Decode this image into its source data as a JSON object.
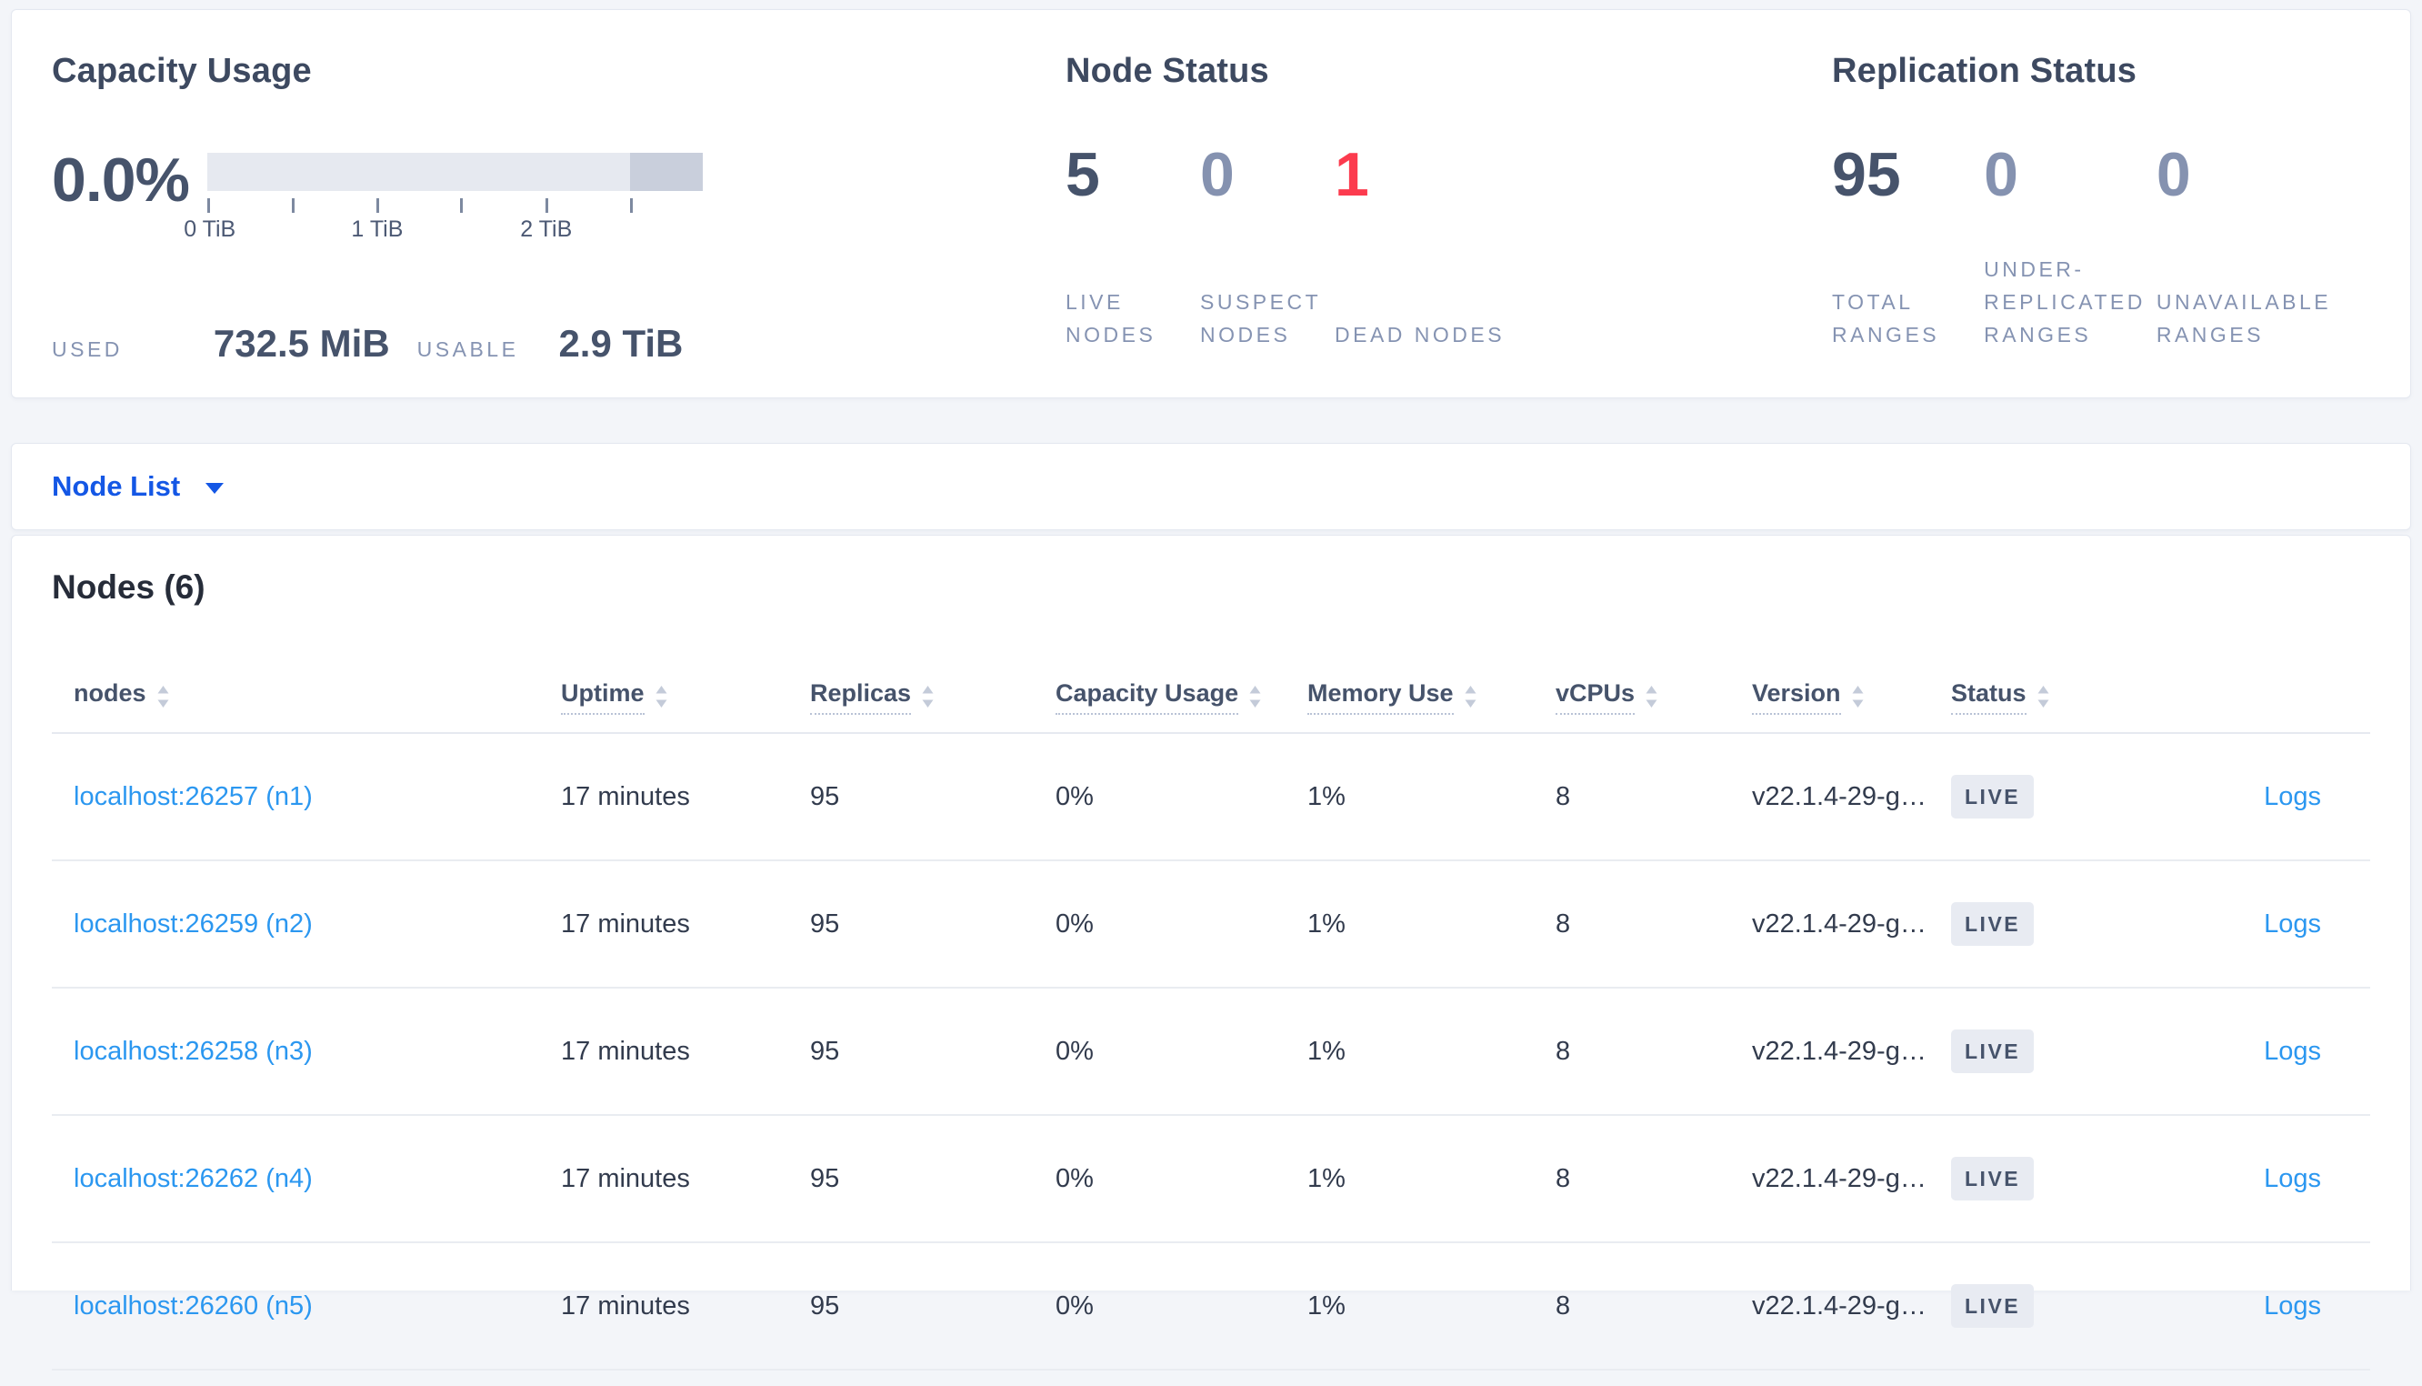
{
  "colors": {
    "page_bg": "#f3f5f9",
    "card_bg": "#ffffff",
    "heading": "#3d4960",
    "stat_primary": "#46536b",
    "stat_muted": "#8592b0",
    "stat_danger": "#fc3b4e",
    "caps_label": "#8593b2",
    "link_blue": "#2b97f0",
    "dropdown_blue": "#1457e5",
    "badge_bg": "#e8ebf2",
    "bar_track": "#e6e9f0",
    "bar_segment": "#c9cfdc",
    "divider": "#e9ecf1"
  },
  "overview": {
    "capacity": {
      "title": "Capacity Usage",
      "percent": "0.0%",
      "axis_ticks": [
        "0 TiB",
        "1 TiB",
        "2 TiB"
      ],
      "used_label": "USED",
      "used_value": "732.5 MiB",
      "usable_label": "USABLE",
      "usable_value": "2.9 TiB"
    },
    "node_status": {
      "title": "Node Status",
      "stats": [
        {
          "value": "5",
          "label": "LIVE NODES"
        },
        {
          "value": "0",
          "label": "SUSPECT NODES"
        },
        {
          "value": "1",
          "label": "DEAD NODES"
        }
      ]
    },
    "replication": {
      "title": "Replication Status",
      "stats": [
        {
          "value": "95",
          "label": "TOTAL RANGES"
        },
        {
          "value": "0",
          "label": "UNDER-REPLICATED RANGES"
        },
        {
          "value": "0",
          "label": "UNAVAILABLE RANGES"
        }
      ]
    }
  },
  "view_selector": {
    "selected": "Node List"
  },
  "nodes": {
    "title": "Nodes (6)",
    "columns": [
      "nodes",
      "Uptime",
      "Replicas",
      "Capacity Usage",
      "Memory Use",
      "vCPUs",
      "Version",
      "Status"
    ],
    "rows": [
      {
        "name": "localhost:26257 (n1)",
        "uptime": "17 minutes",
        "replicas": "95",
        "capacity": "0%",
        "memory": "1%",
        "vcpus": "8",
        "version": "v22.1.4-29-g…",
        "status": "LIVE",
        "logs": "Logs"
      },
      {
        "name": "localhost:26259 (n2)",
        "uptime": "17 minutes",
        "replicas": "95",
        "capacity": "0%",
        "memory": "1%",
        "vcpus": "8",
        "version": "v22.1.4-29-g…",
        "status": "LIVE",
        "logs": "Logs"
      },
      {
        "name": "localhost:26258 (n3)",
        "uptime": "17 minutes",
        "replicas": "95",
        "capacity": "0%",
        "memory": "1%",
        "vcpus": "8",
        "version": "v22.1.4-29-g…",
        "status": "LIVE",
        "logs": "Logs"
      },
      {
        "name": "localhost:26262 (n4)",
        "uptime": "17 minutes",
        "replicas": "95",
        "capacity": "0%",
        "memory": "1%",
        "vcpus": "8",
        "version": "v22.1.4-29-g…",
        "status": "LIVE",
        "logs": "Logs"
      },
      {
        "name": "localhost:26260 (n5)",
        "uptime": "17 minutes",
        "replicas": "95",
        "capacity": "0%",
        "memory": "1%",
        "vcpus": "8",
        "version": "v22.1.4-29-g…",
        "status": "LIVE",
        "logs": "Logs"
      }
    ]
  }
}
